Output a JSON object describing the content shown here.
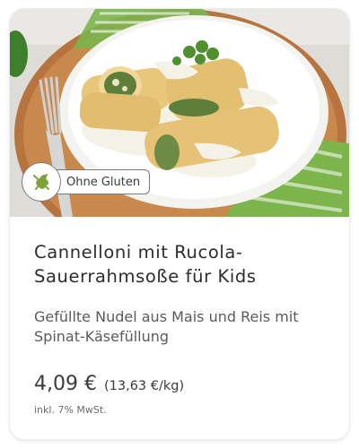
{
  "product": {
    "badge_label": "Ohne Gluten",
    "badge_icon": "wheat-crossed-icon",
    "title": "Cannelloni mit Rucola-Sauerrahmsoße für Kids",
    "description": "Gefüllte Nudel aus Mais und Reis mit Spinat-Käsefüllung",
    "price": "4,09 €",
    "unit_price": "(13,63 €/kg)",
    "tax_note": "inkl. 7% MwSt."
  },
  "colors": {
    "badge_icon_green": "#7ea33b",
    "wood": "#b8743e",
    "napkin_green": "#7bb54c",
    "plate": "#ffffff",
    "pasta": "#e8c77d",
    "sauce": "#f4f1e6",
    "filling": "#5e7f3a"
  }
}
